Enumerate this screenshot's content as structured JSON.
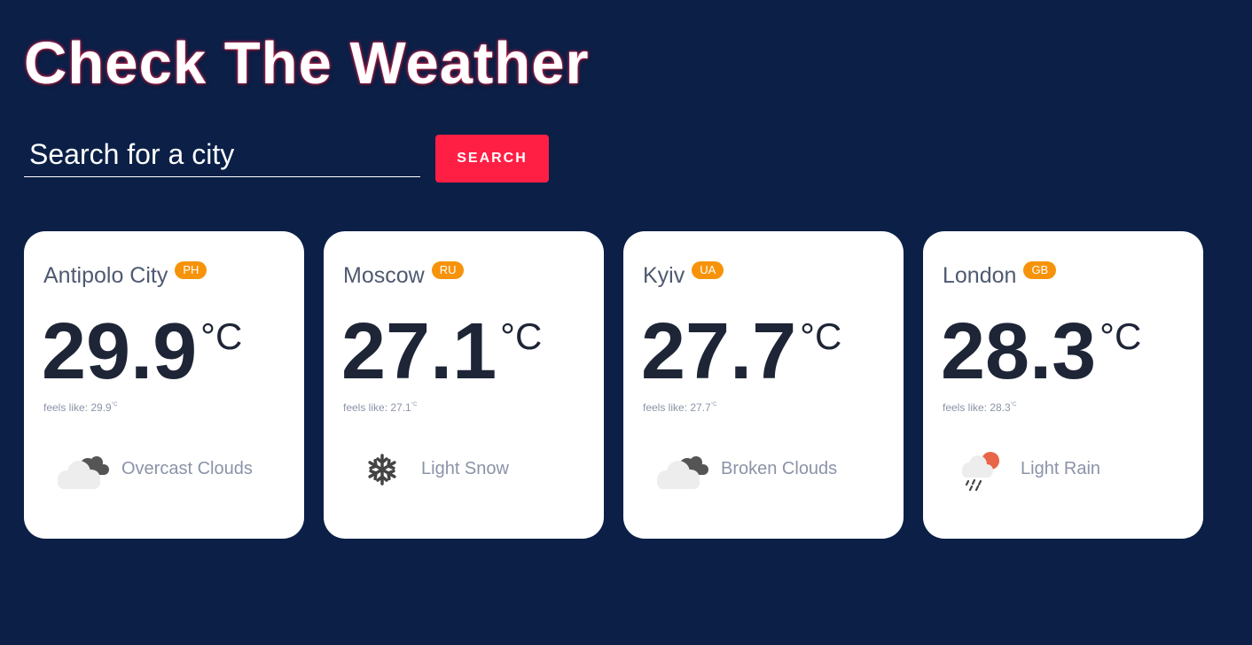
{
  "header": {
    "title": "Check The Weather"
  },
  "search": {
    "placeholder": "Search for a city",
    "value": "",
    "button_label": "SEARCH"
  },
  "colors": {
    "background": "#0b1f47",
    "accent": "#ff1f45",
    "badge": "#f7930a",
    "card": "#ffffff"
  },
  "cards": [
    {
      "city": "Antipolo City",
      "country": "PH",
      "temp": "29.9",
      "unit": "°C",
      "feels_label": "feels like: 29.9",
      "feels_unit": "°C",
      "description": "Overcast Clouds",
      "icon": "overcast-clouds-icon"
    },
    {
      "city": "Moscow",
      "country": "RU",
      "temp": "27.1",
      "unit": "°C",
      "feels_label": "feels like: 27.1",
      "feels_unit": "°C",
      "description": "Light Snow",
      "icon": "snowflake-icon"
    },
    {
      "city": "Kyiv",
      "country": "UA",
      "temp": "27.7",
      "unit": "°C",
      "feels_label": "feels like: 27.7",
      "feels_unit": "°C",
      "description": "Broken Clouds",
      "icon": "broken-clouds-icon"
    },
    {
      "city": "London",
      "country": "GB",
      "temp": "28.3",
      "unit": "°C",
      "feels_label": "feels like: 28.3",
      "feels_unit": "°C",
      "description": "Light Rain",
      "icon": "light-rain-icon"
    }
  ]
}
